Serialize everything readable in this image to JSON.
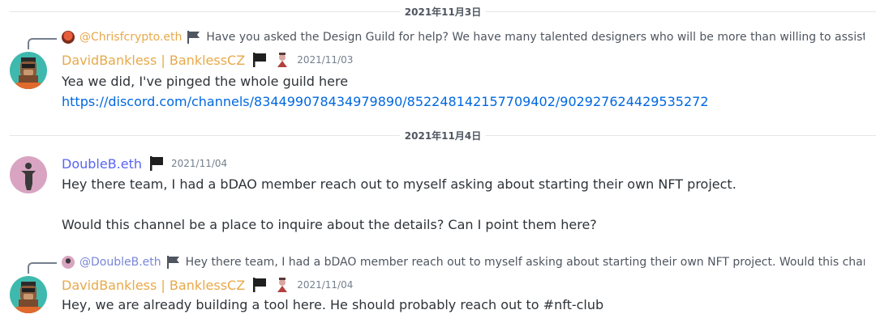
{
  "dividers": [
    "2021年11月3日",
    "2021年11月4日"
  ],
  "colors": {
    "orange_name": "#f0b232",
    "blue_name": "#5865f2",
    "link": "#0068e0",
    "reply_mention_orange": "#e8a94a",
    "reply_mention_blue": "#7a86d8"
  },
  "messages": [
    {
      "reply": {
        "mention": "@Chrisfcrypto.eth",
        "text": "Have you asked the Design Guild for help? We have many talented designers who will be more than willing to assist"
      },
      "author": "DavidBankless | BanklessCZ",
      "timestamp": "2021/11/03",
      "lines": [
        "Yea we did, I've pinged the whole guild here"
      ],
      "link": "https://discord.com/channels/834499078434979890/852248142157709402/902927624429535272"
    },
    {
      "author": "DoubleB.eth",
      "timestamp": "2021/11/04",
      "lines": [
        "Hey there team, I had a bDAO member reach out to myself asking about starting their own NFT project.",
        "Would this channel be a place to inquire about the details?  Can I point them here?"
      ]
    },
    {
      "reply": {
        "mention": "@DoubleB.eth",
        "text": "Hey there team, I had a bDAO member reach out to myself asking about starting their own NFT project.    Would this chan..."
      },
      "author": "DavidBankless | BanklessCZ",
      "timestamp": "2021/11/04",
      "lines": [
        "Hey, we are already building a tool here. He should probably reach out to #nft-club"
      ]
    }
  ]
}
